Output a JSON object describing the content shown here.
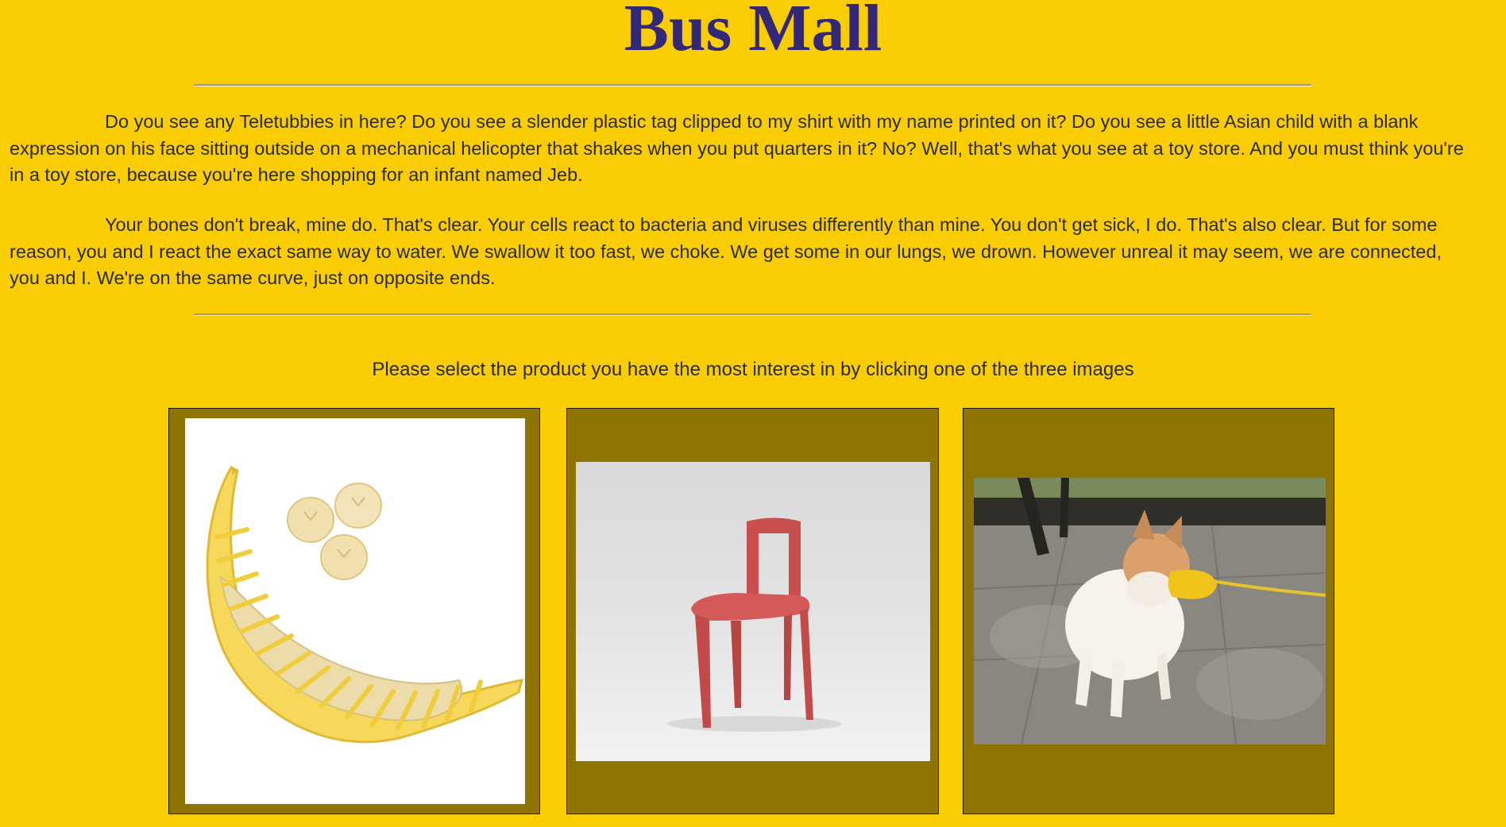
{
  "header": {
    "title": "Bus Mall"
  },
  "intro": {
    "paragraph_1": "Do you see any Teletubbies in here? Do you see a slender plastic tag clipped to my shirt with my name printed on it? Do you see a little Asian child with a blank expression on his face sitting outside on a mechanical helicopter that shakes when you put quarters in it? No? Well, that's what you see at a toy store. And you must think you're in a toy store, because you're here shopping for an infant named Jeb.",
    "paragraph_2": "Your bones don't break, mine do. That's clear. Your cells react to bacteria and viruses differently than mine. You don't get sick, I do. That's also clear. But for some reason, you and I react the exact same way to water. We swallow it too fast, we choke. We get some in our lungs, we drown. However unreal it may seem, we are connected, you and I. We're on the same curve, just on opposite ends."
  },
  "survey": {
    "instruction": "Please select the product you have the most interest in by clicking one of the three images",
    "products": [
      {
        "icon": "banana-slicer-image"
      },
      {
        "icon": "chair-image"
      },
      {
        "icon": "dog-duck-muzzle-image"
      }
    ]
  },
  "colors": {
    "page_background": "#f9cd01",
    "title": "#33277a",
    "card_background": "#907400"
  }
}
